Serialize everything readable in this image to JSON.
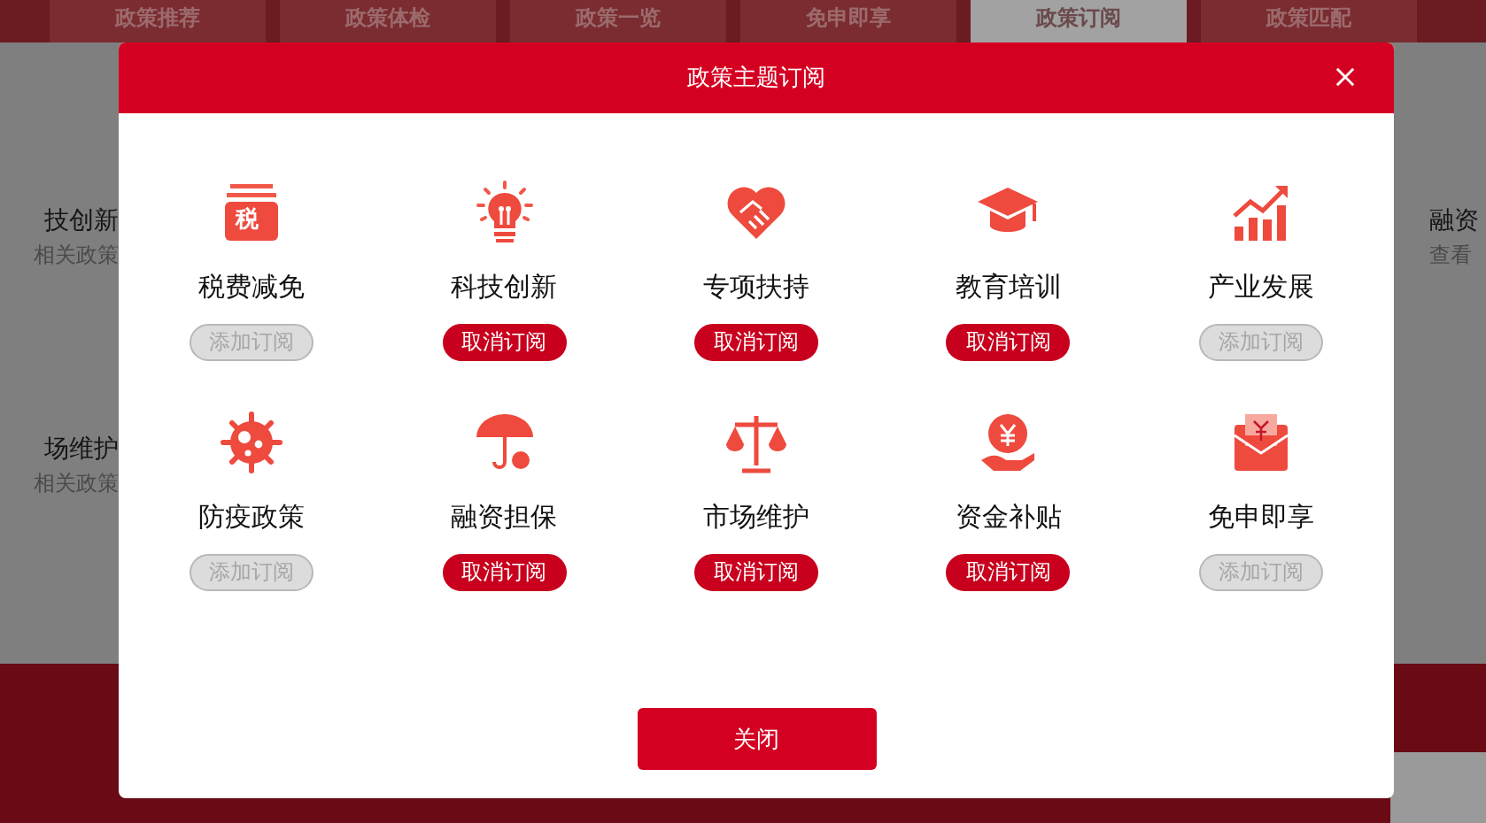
{
  "background": {
    "tabs": [
      {
        "label": "政策推荐",
        "selected": false
      },
      {
        "label": "政策体检",
        "selected": false
      },
      {
        "label": "政策一览",
        "selected": false
      },
      {
        "label": "免申即享",
        "selected": false
      },
      {
        "label": "政策订阅",
        "selected": true
      },
      {
        "label": "政策匹配",
        "selected": false
      }
    ],
    "left_items": [
      {
        "title": "技创新",
        "subtitle": "相关政策"
      },
      {
        "title": "场维护",
        "subtitle": "相关政策"
      }
    ],
    "right_items": [
      {
        "title": "融资",
        "subtitle": "查看"
      }
    ]
  },
  "dialog": {
    "title": "政策主题订阅",
    "topics": [
      {
        "name": "税费减免",
        "kind": "tax",
        "icon_text": "税",
        "subscribed": false,
        "button": "添加订阅"
      },
      {
        "name": "科技创新",
        "kind": "bulb",
        "subscribed": true,
        "button": "取消订阅"
      },
      {
        "name": "专项扶持",
        "kind": "handshake",
        "subscribed": true,
        "button": "取消订阅"
      },
      {
        "name": "教育培训",
        "kind": "cap",
        "subscribed": true,
        "button": "取消订阅"
      },
      {
        "name": "产业发展",
        "kind": "growth",
        "subscribed": false,
        "button": "添加订阅"
      },
      {
        "name": "防疫政策",
        "kind": "virus",
        "subscribed": false,
        "button": "添加订阅"
      },
      {
        "name": "融资担保",
        "kind": "umbrella",
        "subscribed": true,
        "button": "取消订阅"
      },
      {
        "name": "市场维护",
        "kind": "scale",
        "subscribed": true,
        "button": "取消订阅"
      },
      {
        "name": "资金补贴",
        "kind": "money",
        "subscribed": true,
        "button": "取消订阅"
      },
      {
        "name": "免申即享",
        "kind": "envelope",
        "subscribed": false,
        "button": "添加订阅"
      }
    ],
    "close_button": "关闭"
  }
}
